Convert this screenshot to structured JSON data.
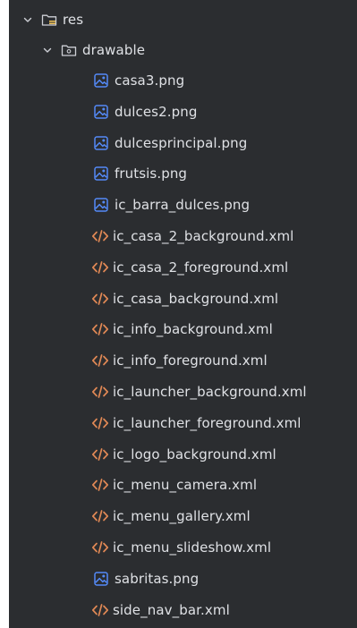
{
  "tree": {
    "root": {
      "label": "res",
      "icon": "resource-folder-icon",
      "expanded": true
    },
    "folder": {
      "label": "drawable",
      "icon": "folder-icon",
      "expanded": true
    },
    "files": [
      {
        "label": "casa3.png",
        "icon": "image-file-icon"
      },
      {
        "label": "dulces2.png",
        "icon": "image-file-icon"
      },
      {
        "label": "dulcesprincipal.png",
        "icon": "image-file-icon"
      },
      {
        "label": "frutsis.png",
        "icon": "image-file-icon"
      },
      {
        "label": "ic_barra_dulces.png",
        "icon": "image-file-icon"
      },
      {
        "label": "ic_casa_2_background.xml",
        "icon": "xml-file-icon"
      },
      {
        "label": "ic_casa_2_foreground.xml",
        "icon": "xml-file-icon"
      },
      {
        "label": "ic_casa_background.xml",
        "icon": "xml-file-icon"
      },
      {
        "label": "ic_info_background.xml",
        "icon": "xml-file-icon"
      },
      {
        "label": "ic_info_foreground.xml",
        "icon": "xml-file-icon"
      },
      {
        "label": "ic_launcher_background.xml",
        "icon": "xml-file-icon"
      },
      {
        "label": "ic_launcher_foreground.xml",
        "icon": "xml-file-icon"
      },
      {
        "label": "ic_logo_background.xml",
        "icon": "xml-file-icon"
      },
      {
        "label": "ic_menu_camera.xml",
        "icon": "xml-file-icon"
      },
      {
        "label": "ic_menu_gallery.xml",
        "icon": "xml-file-icon"
      },
      {
        "label": "ic_menu_slideshow.xml",
        "icon": "xml-file-icon"
      },
      {
        "label": "sabritas.png",
        "icon": "image-file-icon"
      },
      {
        "label": "side_nav_bar.xml",
        "icon": "xml-file-icon"
      }
    ]
  },
  "colors": {
    "background": "#2b2d30",
    "text": "#dfe1e5",
    "image_icon": "#548af7",
    "xml_icon": "#e08855",
    "folder_icon": "#ced0d6",
    "resource_accent": "#f2c55c"
  }
}
